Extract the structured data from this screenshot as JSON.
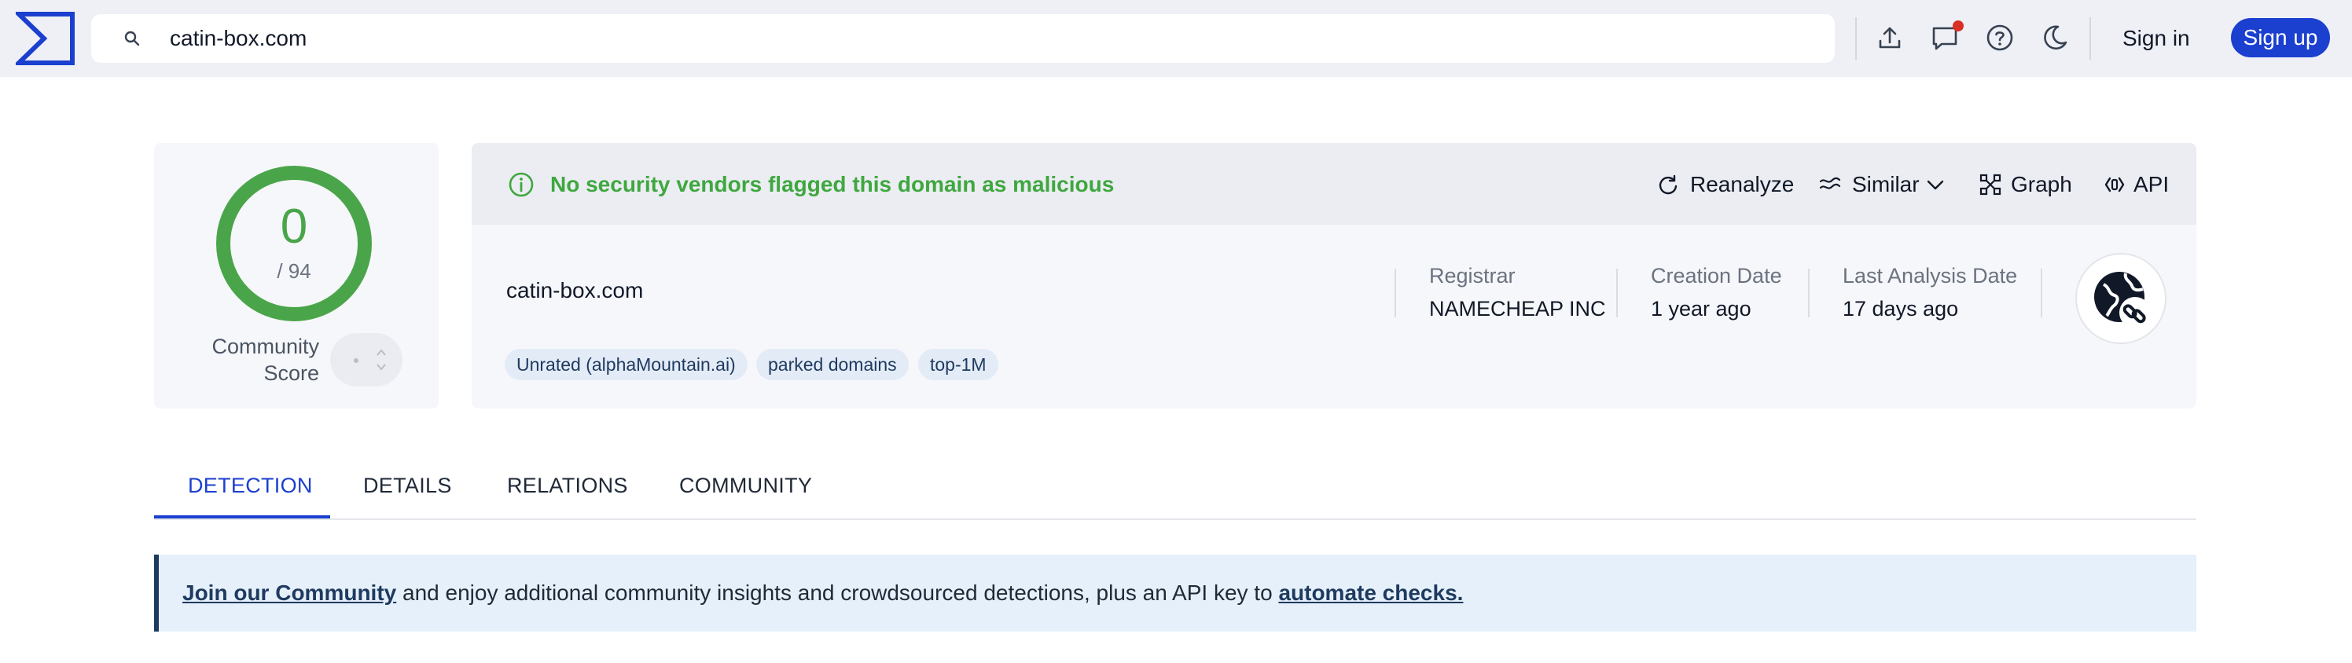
{
  "header": {
    "logo_icon": "virustotal-sigma-logo",
    "search_value": "catin-box.com",
    "icons": [
      "upload-icon",
      "notifications-icon",
      "help-icon",
      "dark-mode-icon"
    ],
    "sign_in": "Sign in",
    "sign_up": "Sign up"
  },
  "score": {
    "detections": "0",
    "total": "/ 94",
    "community_label": "Community Score"
  },
  "banner": {
    "message": "No security vendors flagged this domain as malicious",
    "actions": {
      "reanalyze": "Reanalyze",
      "similar": "Similar",
      "graph": "Graph",
      "api": "API"
    }
  },
  "summary": {
    "domain": "catin-box.com",
    "tags": [
      "Unrated (alphaMountain.ai)",
      "parked domains",
      "top-1M"
    ],
    "registrar_label": "Registrar",
    "registrar_value": "NAMECHEAP INC",
    "creation_label": "Creation Date",
    "creation_value": "1 year ago",
    "last_analysis_label": "Last Analysis Date",
    "last_analysis_value": "17 days ago"
  },
  "tabs": [
    "DETECTION",
    "DETAILS",
    "RELATIONS",
    "COMMUNITY"
  ],
  "active_tab": "DETECTION",
  "community_banner": {
    "link1": "Join our Community",
    "middle": " and enjoy additional community insights and crowdsourced detections, plus an API key to ",
    "link2": "automate checks."
  },
  "colors": {
    "brand_blue": "#1b3fcf",
    "clean_green": "#4aa54a",
    "notification_red": "#d93025"
  }
}
